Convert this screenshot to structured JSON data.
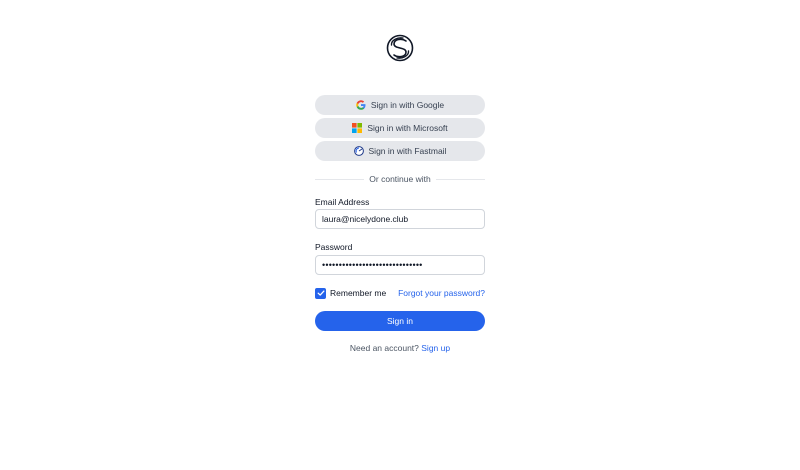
{
  "brand": {
    "logo_icon": "stalwart-s-logo-icon"
  },
  "sso": {
    "google_label": "Sign in with Google",
    "google_icon": "google-icon",
    "microsoft_label": "Sign in with Microsoft",
    "microsoft_icon": "microsoft-icon",
    "fastmail_label": "Sign in with Fastmail",
    "fastmail_icon": "fastmail-icon"
  },
  "divider": {
    "text": "Or continue with"
  },
  "form": {
    "email_label": "Email Address",
    "email_value": "laura@nicelydone.club",
    "password_label": "Password",
    "password_value": "••••••••••••••••••••••••••••••",
    "remember_label": "Remember me",
    "remember_checked": true,
    "forgot_label": "Forgot your password?",
    "submit_label": "Sign in"
  },
  "footer": {
    "prompt": "Need an account?",
    "signup_label": "Sign up"
  },
  "colors": {
    "accent": "#2563eb",
    "button_gray": "#e5e7eb"
  }
}
